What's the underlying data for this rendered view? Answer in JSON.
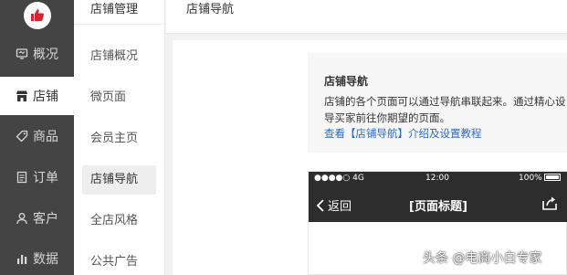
{
  "sidebar": {
    "items": [
      {
        "label": "概况",
        "icon": "dashboard-icon",
        "active": false
      },
      {
        "label": "店铺",
        "icon": "store-icon",
        "active": true
      },
      {
        "label": "商品",
        "icon": "tag-icon",
        "active": false
      },
      {
        "label": "订单",
        "icon": "order-icon",
        "active": false
      },
      {
        "label": "客户",
        "icon": "user-icon",
        "active": false
      },
      {
        "label": "数据",
        "icon": "bar-chart-icon",
        "active": false
      }
    ]
  },
  "submenu": {
    "title": "店铺管理",
    "items": [
      {
        "label": "店铺概况",
        "active": false
      },
      {
        "label": "微页面",
        "active": false
      },
      {
        "label": "会员主页",
        "active": false
      },
      {
        "label": "店铺导航",
        "active": true
      },
      {
        "label": "全店风格",
        "active": false
      },
      {
        "label": "公共广告",
        "active": false
      }
    ]
  },
  "header": {
    "title": "店铺导航"
  },
  "info": {
    "title": "店铺导航",
    "desc_line1": "店铺的各个页面可以通过导航串联起来。通过精心设",
    "desc_line2": "导买家前往你期望的页面。",
    "link": "查看【店铺导航】介绍及设置教程"
  },
  "phone": {
    "status_left": "●●●●○ 4G",
    "status_time": "12:00",
    "status_battery": "100%",
    "back_label": "返回",
    "page_title": "[页面标题]"
  },
  "watermark": "头条 @电商小白专家",
  "colors": {
    "sidebar_bg": "#444444",
    "link": "#2e68c5",
    "phone_bar": "#2d2d2d"
  }
}
